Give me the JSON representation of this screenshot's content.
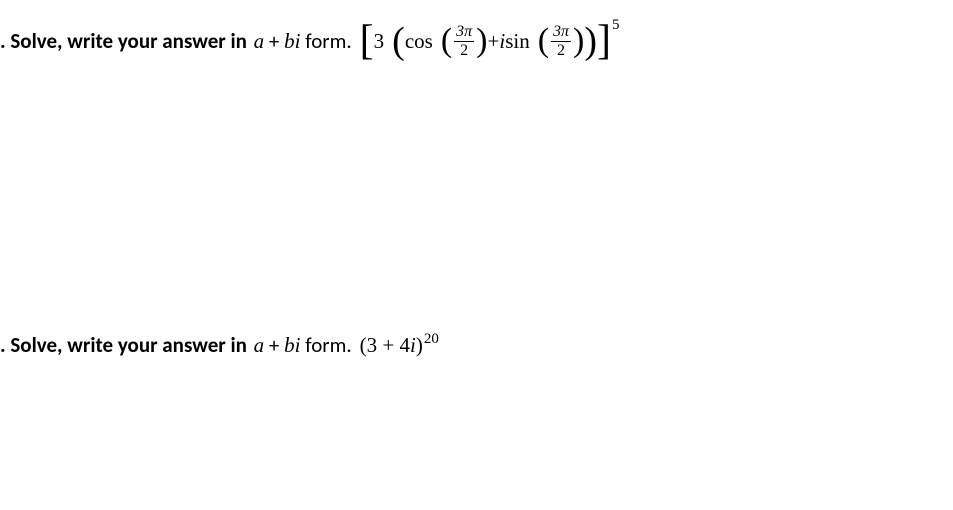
{
  "problems": [
    {
      "prompt_prefix": ". Solve, write your answer in ",
      "var_a": "a",
      "plus": " + ",
      "var_b": "bi",
      "prompt_suffix": " form. ",
      "expr": {
        "bracket_left": "[",
        "coef": "3",
        "paren_outer_left": "(",
        "func1": "cos",
        "paren_inner1_left": "(",
        "frac1_num": "3π",
        "frac1_den": "2",
        "paren_inner1_right": ")",
        "plus": " + ",
        "i": "i",
        "space": " ",
        "func2": "sin",
        "paren_inner2_left": "(",
        "frac2_num": "3π",
        "frac2_den": "2",
        "paren_inner2_right": ")",
        "paren_outer_right": ")",
        "bracket_right": "]",
        "exponent": "5"
      }
    },
    {
      "prompt_prefix": ". Solve, write your answer in ",
      "var_a": "a",
      "plus": " + ",
      "var_b": "bi",
      "prompt_suffix": " form. ",
      "expr": {
        "paren_left": "(",
        "term": "3 + 4",
        "i": "i",
        "paren_right": ")",
        "exponent": "20"
      }
    }
  ]
}
